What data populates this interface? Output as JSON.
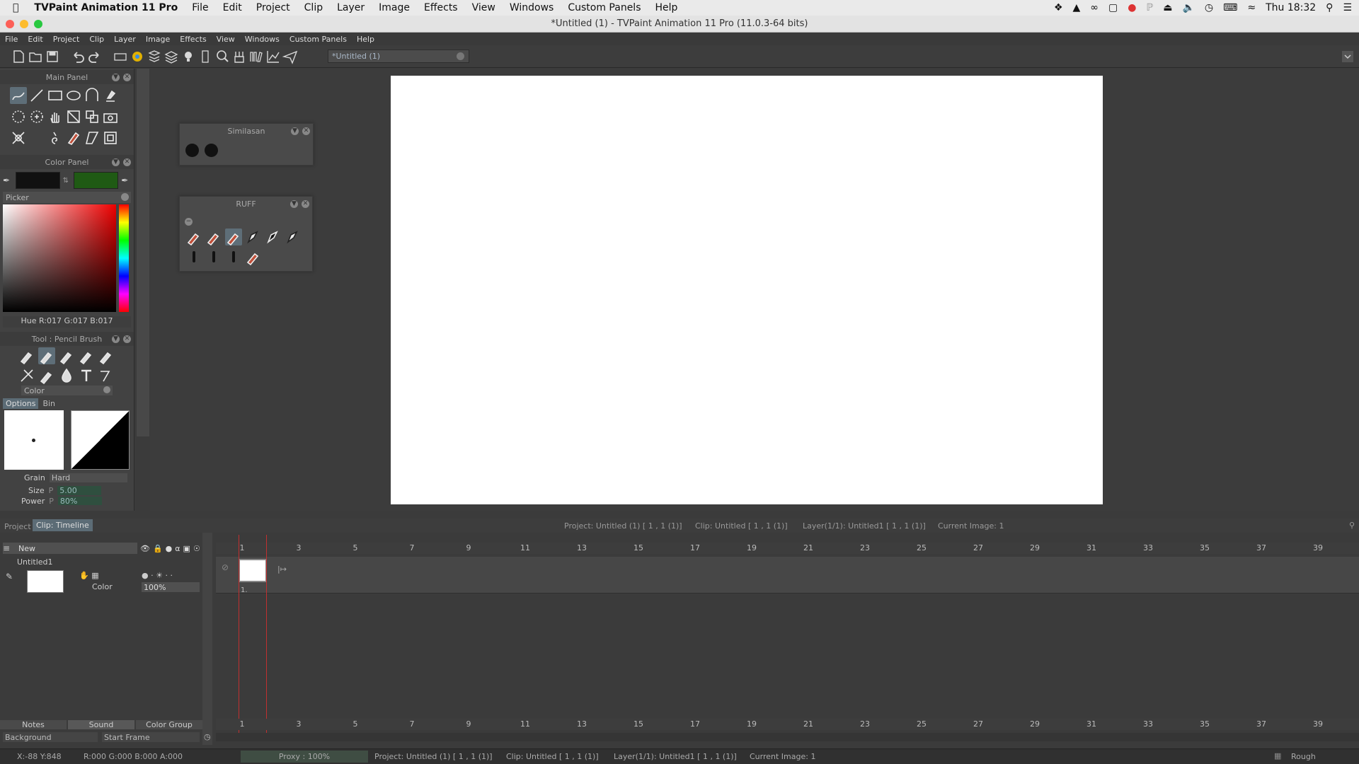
{
  "mac_menubar": {
    "app_name": "TVPaint Animation 11 Pro",
    "items": [
      "File",
      "Edit",
      "Project",
      "Clip",
      "Layer",
      "Image",
      "Effects",
      "View",
      "Windows",
      "Custom Panels",
      "Help"
    ],
    "clock": "Thu 18:32"
  },
  "window": {
    "title": "*Untitled (1) - TVPaint Animation 11 Pro (11.0.3-64 bits)"
  },
  "app_menu": {
    "items": [
      "File",
      "Edit",
      "Project",
      "Clip",
      "Layer",
      "Image",
      "Effects",
      "View",
      "Windows",
      "Custom Panels",
      "Help"
    ]
  },
  "doc_tab": {
    "label": "*Untitled (1)"
  },
  "main_panel": {
    "title": "Main Panel"
  },
  "color_panel": {
    "title": "Color Panel",
    "mode": "Picker",
    "readout": "Hue R:017 G:017 B:017",
    "color_a": "#111111",
    "color_b": "#1f5a14"
  },
  "tool_panel": {
    "title": "Tool : Pencil Brush",
    "mode": "Color",
    "tabs": [
      "Options",
      "Bin"
    ],
    "grain_label": "Grain",
    "grain_value": "Hard",
    "size_label": "Size",
    "size_value": "5.00",
    "power_label": "Power",
    "power_value": "80%",
    "p_flag": "P"
  },
  "similasan_panel": {
    "title": "Similasan"
  },
  "ruff_panel": {
    "title": "RUFF"
  },
  "timeline": {
    "tabs": [
      "Project",
      "Clip: Timeline"
    ],
    "info_project": "Project: Untitled (1) [ 1 , 1  (1)]",
    "info_clip": "Clip: Untitled [ 1 , 1  (1)]",
    "info_layer": "Layer(1/1): Untitled1 [ 1 , 1  (1)]",
    "info_current": "Current Image: 1",
    "layer_dropdown": "New",
    "layer_name": "Untitled1",
    "layer_mode": "Color",
    "layer_opacity": "100%",
    "frame_label": "1.",
    "ruler": [
      "1",
      "3",
      "5",
      "7",
      "9",
      "11",
      "13",
      "15",
      "17",
      "19",
      "21",
      "23",
      "25",
      "27",
      "29",
      "31",
      "33",
      "35",
      "37",
      "39"
    ],
    "bottom_tabs": [
      "Notes",
      "Sound",
      "Color Group"
    ],
    "background_label": "Background",
    "start_frame_label": "Start Frame"
  },
  "status": {
    "coords": "X:-88  Y:848",
    "rgba": "R:000 G:000 B:000 A:000",
    "proxy": "Proxy : 100%",
    "project": "Project: Untitled (1) [ 1 , 1  (1)]",
    "clip": "Clip: Untitled [ 1 , 1  (1)]",
    "layer": "Layer(1/1): Untitled1 [ 1 , 1  (1)]",
    "current": "Current Image: 1",
    "quality": "Rough"
  }
}
